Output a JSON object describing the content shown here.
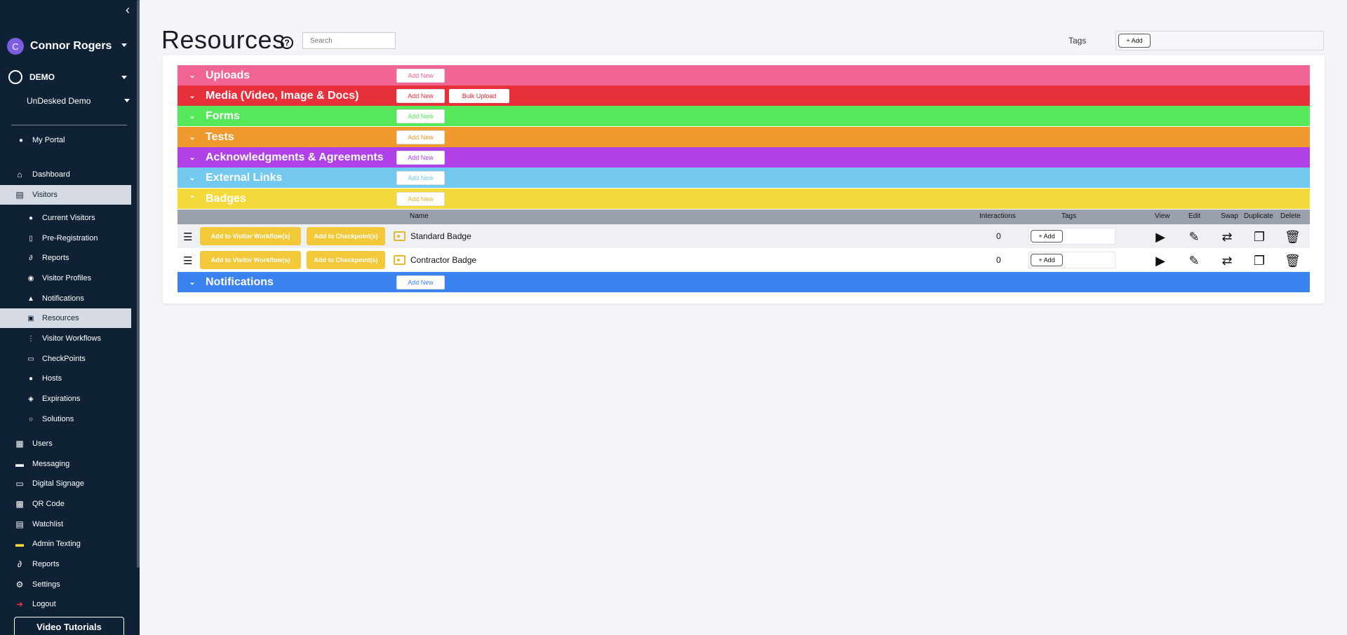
{
  "sidebar": {
    "user": {
      "initial": "C",
      "name": "Connor Rogers"
    },
    "org": {
      "name": "DEMO"
    },
    "site": {
      "name": "UnDesked Demo"
    },
    "items": [
      {
        "label": "My Portal",
        "icon": "person-icon"
      },
      {
        "label": "Dashboard",
        "icon": "home-icon"
      },
      {
        "label": "Visitors",
        "icon": "id-card-icon"
      },
      {
        "label": "Current Visitors",
        "icon": "people-icon"
      },
      {
        "label": "Pre-Registration",
        "icon": "clipboard-icon"
      },
      {
        "label": "Reports",
        "icon": "paperclip-icon"
      },
      {
        "label": "Visitor Profiles",
        "icon": "disc-icon"
      },
      {
        "label": "Notifications",
        "icon": "bell-icon"
      },
      {
        "label": "Resources",
        "icon": "folders-icon"
      },
      {
        "label": "Visitor Workflows",
        "icon": "workflow-icon"
      },
      {
        "label": "CheckPoints",
        "icon": "monitor-icon"
      },
      {
        "label": "Hosts",
        "icon": "host-icon"
      },
      {
        "label": "Expirations",
        "icon": "expiration-icon"
      },
      {
        "label": "Solutions",
        "icon": "bulb-icon"
      },
      {
        "label": "Users",
        "icon": "users-icon"
      },
      {
        "label": "Messaging",
        "icon": "chat-icon"
      },
      {
        "label": "Digital Signage",
        "icon": "monitor-icon"
      },
      {
        "label": "QR Code",
        "icon": "qr-icon"
      },
      {
        "label": "Watchlist",
        "icon": "watchlist-icon"
      },
      {
        "label": "Admin Texting",
        "icon": "sms-icon"
      },
      {
        "label": "Reports",
        "icon": "paperclip-icon"
      },
      {
        "label": "Settings",
        "icon": "gear-icon"
      },
      {
        "label": "Logout",
        "icon": "logout-icon"
      }
    ],
    "video_tutorials": "Video Tutorials"
  },
  "header": {
    "title": "Resources",
    "search_placeholder": "Search",
    "tags_label": "Tags",
    "tags_add": "+ Add"
  },
  "sections": [
    {
      "title": "Uploads",
      "color": "#f06593",
      "add": "Add New"
    },
    {
      "title": "Media (Video, Image & Docs)",
      "color": "#e8303d",
      "add": "Add New",
      "bulk": "Bulk Upload"
    },
    {
      "title": "Forms",
      "color": "#55e85a",
      "add": "Add New"
    },
    {
      "title": "Tests",
      "color": "#f0992f",
      "add": "Add New"
    },
    {
      "title": "Acknowledgments & Agreements",
      "color": "#b040e8",
      "add": "Add New"
    },
    {
      "title": "External Links",
      "color": "#72c8ee",
      "add": "Add New"
    },
    {
      "title": "Badges",
      "color": "#f4d93a",
      "add": "Add New"
    },
    {
      "title": "Notifications",
      "color": "#3a82ef",
      "add": "Add New"
    }
  ],
  "table": {
    "columns": {
      "name": "Name",
      "interactions": "Interactions",
      "tags": "Tags",
      "view": "View",
      "edit": "Edit",
      "swap": "Swap",
      "duplicate": "Duplicate",
      "delete": "Delete"
    },
    "rows": [
      {
        "workflow_btn": "Add to Visitor Workflow(s)",
        "checkpoint_btn": "Add to Checkpoint(s)",
        "name": "Standard Badge",
        "interactions": "0",
        "tag_add": "+ Add"
      },
      {
        "workflow_btn": "Add to Visitor Workflow(s)",
        "checkpoint_btn": "Add to Checkpoint(s)",
        "name": "Contractor Badge",
        "interactions": "0",
        "tag_add": "+ Add"
      }
    ]
  }
}
